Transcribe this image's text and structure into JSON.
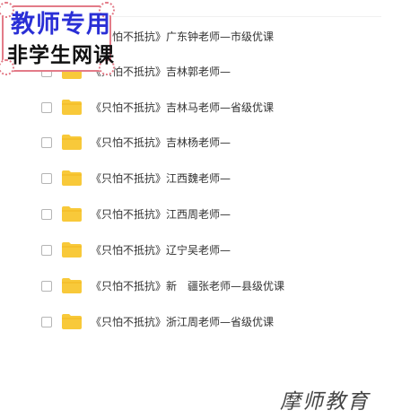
{
  "badge": {
    "line1": "教师专用",
    "line2": "非学生网课"
  },
  "files": [
    {
      "name": "《只怕不抵抗》广东钟老师—市级优课",
      "icon": "folder-icon"
    },
    {
      "name": "《只怕不抵抗》吉林郭老师—",
      "icon": "folder-icon"
    },
    {
      "name": "《只怕不抵抗》吉林马老师—省级优课",
      "icon": "folder-icon"
    },
    {
      "name": "《只怕不抵抗》吉林杨老师—",
      "icon": "folder-icon"
    },
    {
      "name": "《只怕不抵抗》江西魏老师—",
      "icon": "folder-icon"
    },
    {
      "name": "《只怕不抵抗》江西周老师—",
      "icon": "folder-icon"
    },
    {
      "name": "《只怕不抵抗》辽宁吴老师—",
      "icon": "folder-icon"
    },
    {
      "name": "《只怕不抵抗》新　疆张老师—县级优课",
      "icon": "folder-icon"
    },
    {
      "name": "《只怕不抵抗》浙江周老师—省级优课",
      "icon": "folder-icon"
    }
  ],
  "watermark": "摩师教育",
  "colors": {
    "folder": "#f8c93a",
    "badge_border": "#e37b88",
    "badge_title": "#2a2fd6"
  }
}
